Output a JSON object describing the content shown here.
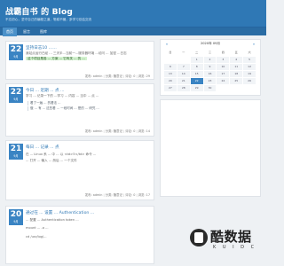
{
  "header": {
    "title": "战霸自书 的 Blog",
    "description": "不忘初心，坚守自己的编程之道，笔耕不辍，多学习总结交流"
  },
  "nav": {
    "items": [
      {
        "label": "首页",
        "active": true
      },
      {
        "label": "留言"
      },
      {
        "label": "图库"
      }
    ]
  },
  "posts": [
    {
      "day": "22",
      "month": "9月",
      "title": "坚持日志10 ……",
      "lines": [
        "我站点运行已经 ... 三天半...当前一...服务器环境 ...访问 ... 加密 ...日志"
      ],
      "highlight": "这个项目是各 ... 方案 ... 它有关 ... 的 ...",
      "meta": {
        "author": "发布: admin",
        "category": "分类: 随意记",
        "comments": "评论: 0",
        "views": "浏览: 29"
      }
    },
    {
      "day": "22",
      "month": "9月",
      "title": "今日 ... 近期 ... 点 ...",
      "lines": [
        "学习 ... 记录一下的 ...学习 ... 内容 ... 当中 ... 点 ..."
      ],
      "quote": [
        "看了一遍 ... 的看法 ...",
        "做 ... 有 ... 这些看 ... 一段时间 ... 是的 ... 研究 ..."
      ],
      "meta": {
        "author": "发布: admin",
        "category": "分类: 随意记",
        "comments": "评论: 0",
        "views": "浏览: 14"
      }
    },
    {
      "day": "21",
      "month": "9月",
      "title": "每日 ... 记录 ... 点",
      "lines": [
        "在 ... Linux 系 ... 中 ... 以 <td>5</td> 命令 ...",
        "... 打开 ... 输入 ... 然后 ... 一个文件"
      ],
      "meta": {
        "author": "发布: admin",
        "category": "分类: 随意记",
        "comments": "评论: 0",
        "views": "浏览: 17"
      }
    },
    {
      "day": "20",
      "month": "9月",
      "title": "通过在 ... 设置 ... Authentication ...",
      "lines": [
        "... 配置 ... Authentication token ...",
        "mount ... -o ...",
        "cd /usr/log/..."
      ],
      "meta": {
        "author": "",
        "category": "",
        "comments": "",
        "views": ""
      }
    }
  ],
  "calendar": {
    "title": "2020年 09月",
    "weekdays": [
      "日",
      "一",
      "二",
      "三",
      "四",
      "五",
      "六"
    ],
    "weeks": [
      [
        "",
        "",
        "1",
        "2",
        "3",
        "4",
        "5"
      ],
      [
        "6",
        "7",
        "8",
        "9",
        "10",
        "11",
        "12"
      ],
      [
        "13",
        "14",
        "15",
        "16",
        "17",
        "18",
        "19"
      ],
      [
        "20",
        "21",
        "22",
        "23",
        "24",
        "25",
        "26"
      ],
      [
        "27",
        "28",
        "29",
        "30",
        "",
        "",
        ""
      ]
    ],
    "today": "22",
    "prev": "«",
    "next": "»"
  },
  "watermark": {
    "text": "酷数据",
    "sub": "K U I D C"
  },
  "colors": {
    "accent": "#2f78b5",
    "highlight": "#d3f2cf"
  }
}
